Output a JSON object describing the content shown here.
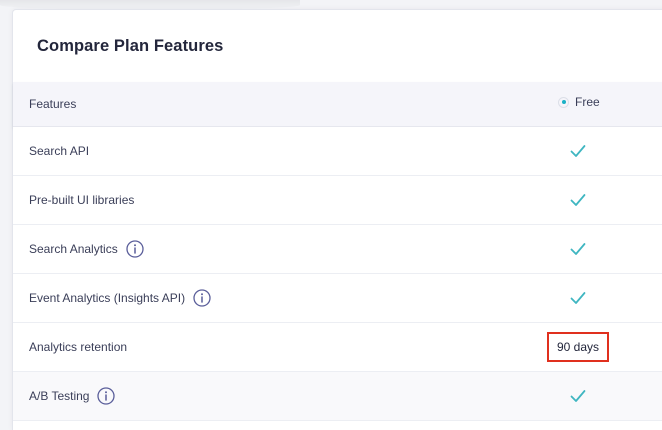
{
  "card": {
    "title": "Compare Plan Features"
  },
  "table": {
    "header_features": "Features",
    "plan_name": "Free",
    "rows": [
      {
        "label": "Search API",
        "value": "check"
      },
      {
        "label": "Pre-built UI libraries",
        "value": "check"
      },
      {
        "label": "Search Analytics",
        "value": "check",
        "info": true
      },
      {
        "label": "Event Analytics (Insights API)",
        "value": "check",
        "info": true
      },
      {
        "label": "Analytics retention",
        "value": "90 days",
        "highlighted": true
      },
      {
        "label": "A/B Testing",
        "value": "check",
        "info": true
      }
    ]
  },
  "colors": {
    "check": "#3fb6c1",
    "info_icon": "#5a5e9a",
    "highlight_border": "#e0301e",
    "plan_dot": "#1ab1c6"
  },
  "icons": {
    "check": "check-icon",
    "info": "info-icon",
    "plan": "plan-indicator-icon"
  }
}
